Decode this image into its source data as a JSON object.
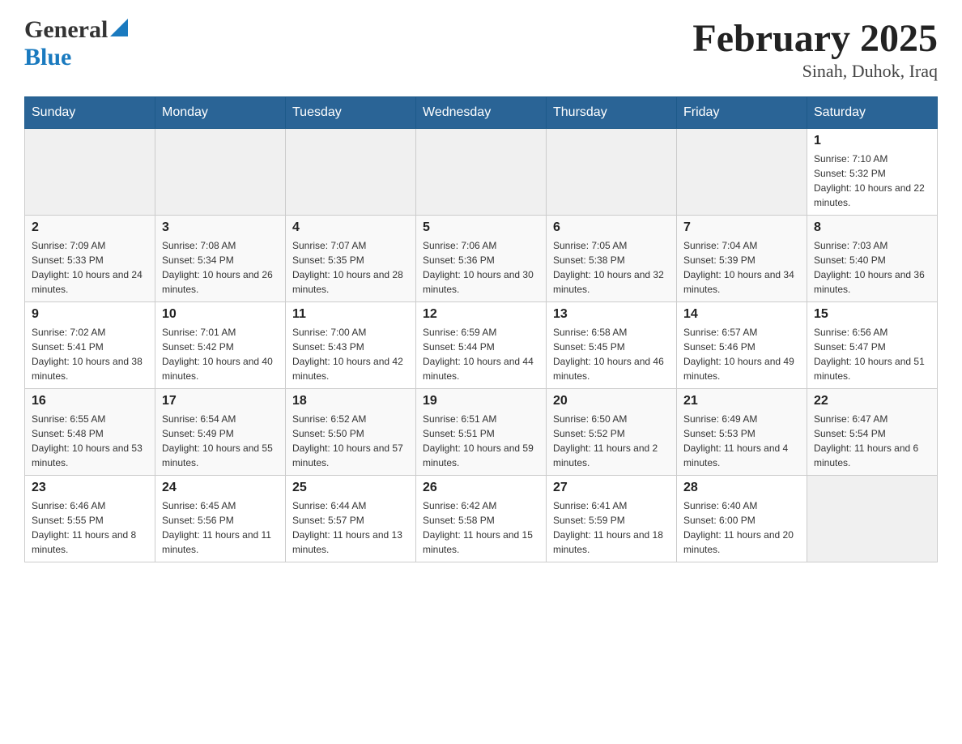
{
  "header": {
    "logo_general": "General",
    "logo_blue": "Blue",
    "title": "February 2025",
    "subtitle": "Sinah, Duhok, Iraq"
  },
  "weekdays": [
    "Sunday",
    "Monday",
    "Tuesday",
    "Wednesday",
    "Thursday",
    "Friday",
    "Saturday"
  ],
  "weeks": [
    [
      {
        "day": "",
        "sunrise": "",
        "sunset": "",
        "daylight": ""
      },
      {
        "day": "",
        "sunrise": "",
        "sunset": "",
        "daylight": ""
      },
      {
        "day": "",
        "sunrise": "",
        "sunset": "",
        "daylight": ""
      },
      {
        "day": "",
        "sunrise": "",
        "sunset": "",
        "daylight": ""
      },
      {
        "day": "",
        "sunrise": "",
        "sunset": "",
        "daylight": ""
      },
      {
        "day": "",
        "sunrise": "",
        "sunset": "",
        "daylight": ""
      },
      {
        "day": "1",
        "sunrise": "Sunrise: 7:10 AM",
        "sunset": "Sunset: 5:32 PM",
        "daylight": "Daylight: 10 hours and 22 minutes."
      }
    ],
    [
      {
        "day": "2",
        "sunrise": "Sunrise: 7:09 AM",
        "sunset": "Sunset: 5:33 PM",
        "daylight": "Daylight: 10 hours and 24 minutes."
      },
      {
        "day": "3",
        "sunrise": "Sunrise: 7:08 AM",
        "sunset": "Sunset: 5:34 PM",
        "daylight": "Daylight: 10 hours and 26 minutes."
      },
      {
        "day": "4",
        "sunrise": "Sunrise: 7:07 AM",
        "sunset": "Sunset: 5:35 PM",
        "daylight": "Daylight: 10 hours and 28 minutes."
      },
      {
        "day": "5",
        "sunrise": "Sunrise: 7:06 AM",
        "sunset": "Sunset: 5:36 PM",
        "daylight": "Daylight: 10 hours and 30 minutes."
      },
      {
        "day": "6",
        "sunrise": "Sunrise: 7:05 AM",
        "sunset": "Sunset: 5:38 PM",
        "daylight": "Daylight: 10 hours and 32 minutes."
      },
      {
        "day": "7",
        "sunrise": "Sunrise: 7:04 AM",
        "sunset": "Sunset: 5:39 PM",
        "daylight": "Daylight: 10 hours and 34 minutes."
      },
      {
        "day": "8",
        "sunrise": "Sunrise: 7:03 AM",
        "sunset": "Sunset: 5:40 PM",
        "daylight": "Daylight: 10 hours and 36 minutes."
      }
    ],
    [
      {
        "day": "9",
        "sunrise": "Sunrise: 7:02 AM",
        "sunset": "Sunset: 5:41 PM",
        "daylight": "Daylight: 10 hours and 38 minutes."
      },
      {
        "day": "10",
        "sunrise": "Sunrise: 7:01 AM",
        "sunset": "Sunset: 5:42 PM",
        "daylight": "Daylight: 10 hours and 40 minutes."
      },
      {
        "day": "11",
        "sunrise": "Sunrise: 7:00 AM",
        "sunset": "Sunset: 5:43 PM",
        "daylight": "Daylight: 10 hours and 42 minutes."
      },
      {
        "day": "12",
        "sunrise": "Sunrise: 6:59 AM",
        "sunset": "Sunset: 5:44 PM",
        "daylight": "Daylight: 10 hours and 44 minutes."
      },
      {
        "day": "13",
        "sunrise": "Sunrise: 6:58 AM",
        "sunset": "Sunset: 5:45 PM",
        "daylight": "Daylight: 10 hours and 46 minutes."
      },
      {
        "day": "14",
        "sunrise": "Sunrise: 6:57 AM",
        "sunset": "Sunset: 5:46 PM",
        "daylight": "Daylight: 10 hours and 49 minutes."
      },
      {
        "day": "15",
        "sunrise": "Sunrise: 6:56 AM",
        "sunset": "Sunset: 5:47 PM",
        "daylight": "Daylight: 10 hours and 51 minutes."
      }
    ],
    [
      {
        "day": "16",
        "sunrise": "Sunrise: 6:55 AM",
        "sunset": "Sunset: 5:48 PM",
        "daylight": "Daylight: 10 hours and 53 minutes."
      },
      {
        "day": "17",
        "sunrise": "Sunrise: 6:54 AM",
        "sunset": "Sunset: 5:49 PM",
        "daylight": "Daylight: 10 hours and 55 minutes."
      },
      {
        "day": "18",
        "sunrise": "Sunrise: 6:52 AM",
        "sunset": "Sunset: 5:50 PM",
        "daylight": "Daylight: 10 hours and 57 minutes."
      },
      {
        "day": "19",
        "sunrise": "Sunrise: 6:51 AM",
        "sunset": "Sunset: 5:51 PM",
        "daylight": "Daylight: 10 hours and 59 minutes."
      },
      {
        "day": "20",
        "sunrise": "Sunrise: 6:50 AM",
        "sunset": "Sunset: 5:52 PM",
        "daylight": "Daylight: 11 hours and 2 minutes."
      },
      {
        "day": "21",
        "sunrise": "Sunrise: 6:49 AM",
        "sunset": "Sunset: 5:53 PM",
        "daylight": "Daylight: 11 hours and 4 minutes."
      },
      {
        "day": "22",
        "sunrise": "Sunrise: 6:47 AM",
        "sunset": "Sunset: 5:54 PM",
        "daylight": "Daylight: 11 hours and 6 minutes."
      }
    ],
    [
      {
        "day": "23",
        "sunrise": "Sunrise: 6:46 AM",
        "sunset": "Sunset: 5:55 PM",
        "daylight": "Daylight: 11 hours and 8 minutes."
      },
      {
        "day": "24",
        "sunrise": "Sunrise: 6:45 AM",
        "sunset": "Sunset: 5:56 PM",
        "daylight": "Daylight: 11 hours and 11 minutes."
      },
      {
        "day": "25",
        "sunrise": "Sunrise: 6:44 AM",
        "sunset": "Sunset: 5:57 PM",
        "daylight": "Daylight: 11 hours and 13 minutes."
      },
      {
        "day": "26",
        "sunrise": "Sunrise: 6:42 AM",
        "sunset": "Sunset: 5:58 PM",
        "daylight": "Daylight: 11 hours and 15 minutes."
      },
      {
        "day": "27",
        "sunrise": "Sunrise: 6:41 AM",
        "sunset": "Sunset: 5:59 PM",
        "daylight": "Daylight: 11 hours and 18 minutes."
      },
      {
        "day": "28",
        "sunrise": "Sunrise: 6:40 AM",
        "sunset": "Sunset: 6:00 PM",
        "daylight": "Daylight: 11 hours and 20 minutes."
      },
      {
        "day": "",
        "sunrise": "",
        "sunset": "",
        "daylight": ""
      }
    ]
  ]
}
